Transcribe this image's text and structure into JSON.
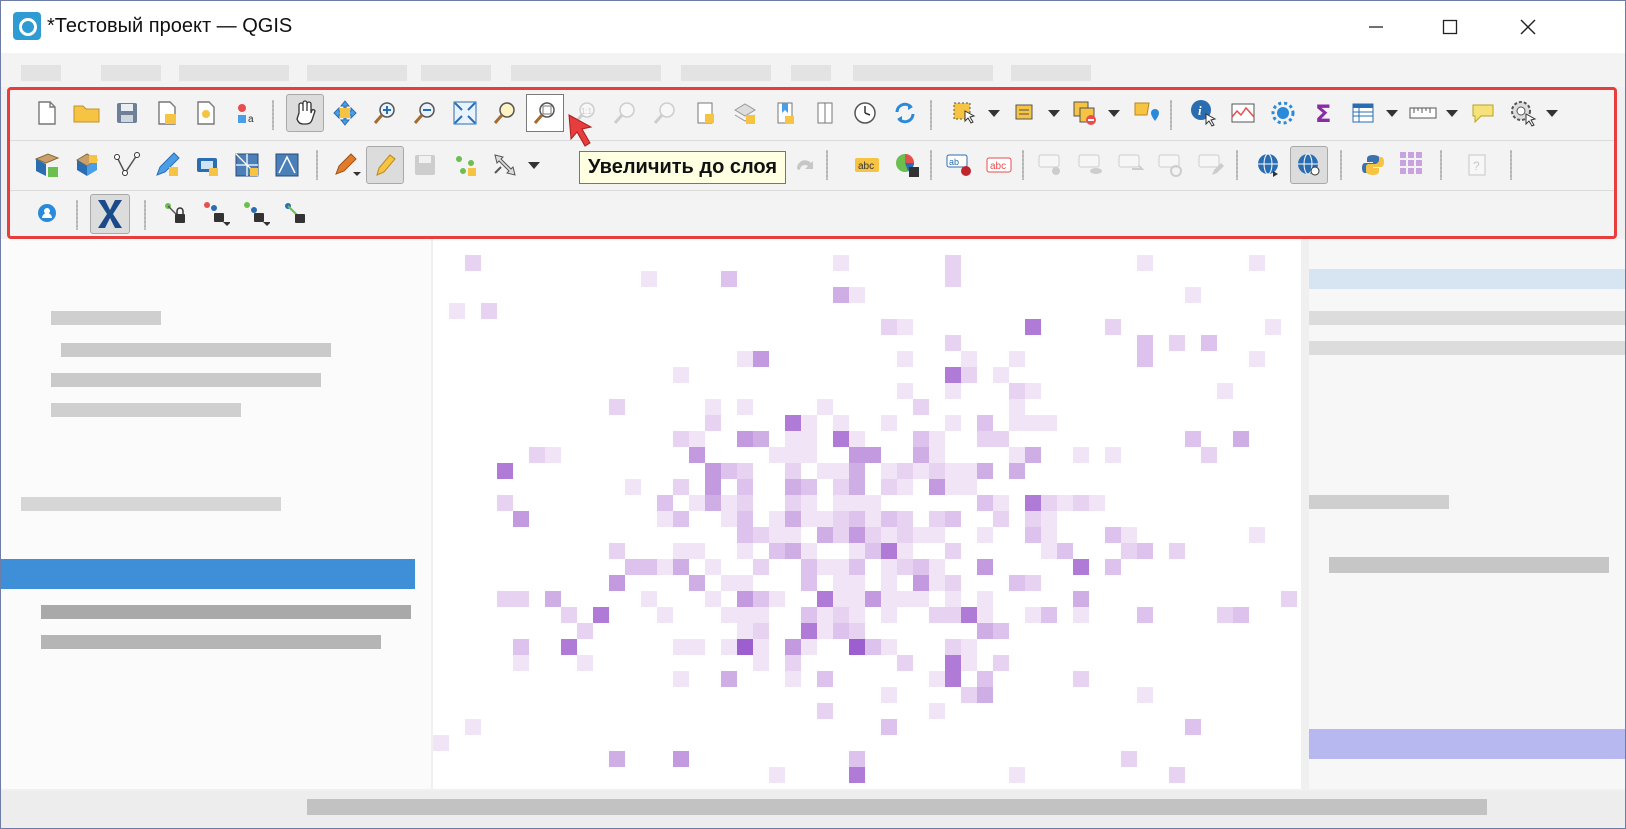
{
  "window": {
    "title": "*Тестовый проект — QGIS"
  },
  "tooltip": {
    "text": "Увеличить до слоя"
  },
  "toolbar_rows": [
    {
      "buttons": [
        {
          "icon": "new-project-icon"
        },
        {
          "icon": "open-project-icon"
        },
        {
          "icon": "save-project-icon"
        },
        {
          "icon": "new-print-layout-icon"
        },
        {
          "icon": "layout-manager-icon"
        },
        {
          "icon": "style-manager-icon"
        },
        {
          "icon": "pan-hand-icon",
          "state": "active"
        },
        {
          "icon": "pan-to-selection-icon"
        },
        {
          "icon": "zoom-in-icon"
        },
        {
          "icon": "zoom-out-icon"
        },
        {
          "icon": "zoom-full-icon"
        },
        {
          "icon": "zoom-to-selection-icon"
        },
        {
          "icon": "zoom-to-layer-icon",
          "state": "hovered"
        },
        {
          "icon": "zoom-native-icon",
          "state": "disabled"
        },
        {
          "icon": "zoom-last-icon",
          "state": "disabled"
        },
        {
          "icon": "zoom-next-icon",
          "state": "disabled"
        },
        {
          "icon": "new-bookmark-icon"
        },
        {
          "icon": "new-spatial-bookmark-icon"
        },
        {
          "icon": "show-bookmarks-icon"
        },
        {
          "icon": "temporal-controller-icon"
        },
        {
          "icon": "refresh-icon"
        },
        {
          "icon": "select-features-icon"
        },
        {
          "icon": "select-by-value-icon"
        },
        {
          "icon": "deselect-icon"
        },
        {
          "icon": "annotation-icon"
        },
        {
          "icon": "identify-features-icon"
        },
        {
          "icon": "open-attribute-table-icon"
        },
        {
          "icon": "processing-toolbox-icon"
        },
        {
          "icon": "statistics-sum-icon"
        },
        {
          "icon": "attribute-table-icon"
        },
        {
          "icon": "measure-line-icon"
        },
        {
          "icon": "map-tips-icon"
        },
        {
          "icon": "run-feature-action-icon"
        }
      ]
    },
    {
      "buttons": [
        {
          "icon": "data-source-manager-icon"
        },
        {
          "icon": "new-geopackage-layer-icon"
        },
        {
          "icon": "vertex-tool-icon"
        },
        {
          "icon": "digitize-icon"
        },
        {
          "icon": "gps-icon"
        },
        {
          "icon": "new-mesh-layer-icon"
        },
        {
          "icon": "vertex-editor-icon"
        },
        {
          "icon": "current-edits-icon"
        },
        {
          "icon": "toggle-editing-icon",
          "state": "active"
        },
        {
          "icon": "save-edits-icon",
          "state": "disabled"
        },
        {
          "icon": "add-point-icon"
        },
        {
          "icon": "move-feature-icon"
        },
        {
          "icon": "redo-icon",
          "state": "disabled"
        },
        {
          "icon": "label-icon"
        },
        {
          "icon": "diagram-icon"
        },
        {
          "icon": "pin-label-icon"
        },
        {
          "icon": "highlight-label-icon"
        },
        {
          "icon": "move-label-icon",
          "state": "disabled"
        },
        {
          "icon": "show-hide-label-icon",
          "state": "disabled"
        },
        {
          "icon": "rotate-label-icon",
          "state": "disabled"
        },
        {
          "icon": "change-label-icon",
          "state": "disabled"
        },
        {
          "icon": "edit-label-icon",
          "state": "disabled"
        },
        {
          "icon": "globe-icon"
        },
        {
          "icon": "globe-search-icon",
          "state": "active"
        },
        {
          "icon": "python-console-icon"
        },
        {
          "icon": "plugin-grid-icon"
        },
        {
          "icon": "help-icon",
          "state": "disabled"
        }
      ]
    },
    {
      "buttons": [
        {
          "icon": "user-profile-icon"
        },
        {
          "icon": "x-tool-icon",
          "state": "active"
        },
        {
          "icon": "snapping-lock-icon"
        },
        {
          "icon": "snapping-lock-dropdown-icon"
        },
        {
          "icon": "snapping-vertex-lock-icon"
        },
        {
          "icon": "snapping-segment-lock-icon"
        }
      ]
    }
  ],
  "colors": {
    "highlight_border": "#e83d3d",
    "tooltip_bg": "#ffffe1",
    "map_tint": "#c9a3e0"
  }
}
